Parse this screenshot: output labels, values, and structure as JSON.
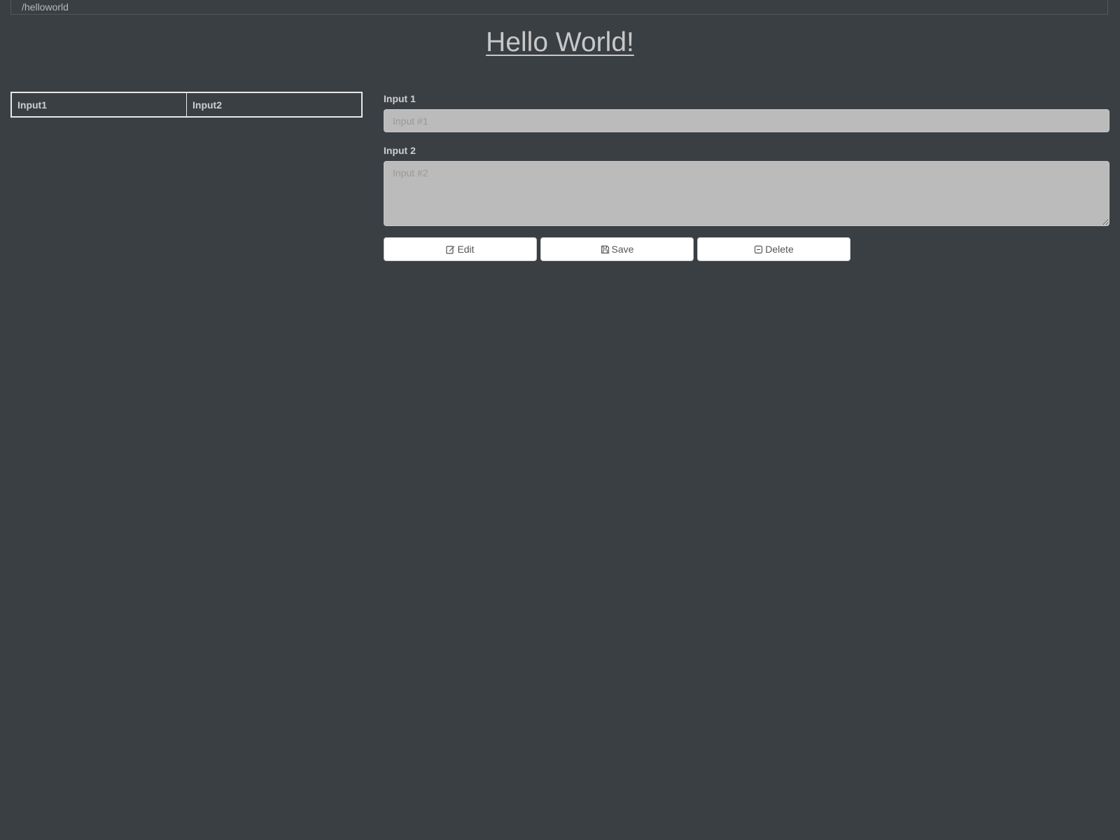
{
  "breadcrumb": {
    "path": "/helloworld"
  },
  "header": {
    "title": "Hello World!"
  },
  "table": {
    "columns": [
      "Input1",
      "Input2"
    ]
  },
  "form": {
    "input1": {
      "label": "Input 1",
      "placeholder": "Input #1",
      "value": ""
    },
    "input2": {
      "label": "Input 2",
      "placeholder": "Input #2",
      "value": ""
    }
  },
  "actions": {
    "edit": {
      "label": "Edit",
      "icon": "edit-icon"
    },
    "save": {
      "label": "Save",
      "icon": "save-icon"
    },
    "delete": {
      "label": "Delete",
      "icon": "minus-square-icon"
    }
  },
  "colors": {
    "background": "#3a3f44",
    "input_background": "#bbbbbb",
    "button_background": "#ffffff"
  }
}
